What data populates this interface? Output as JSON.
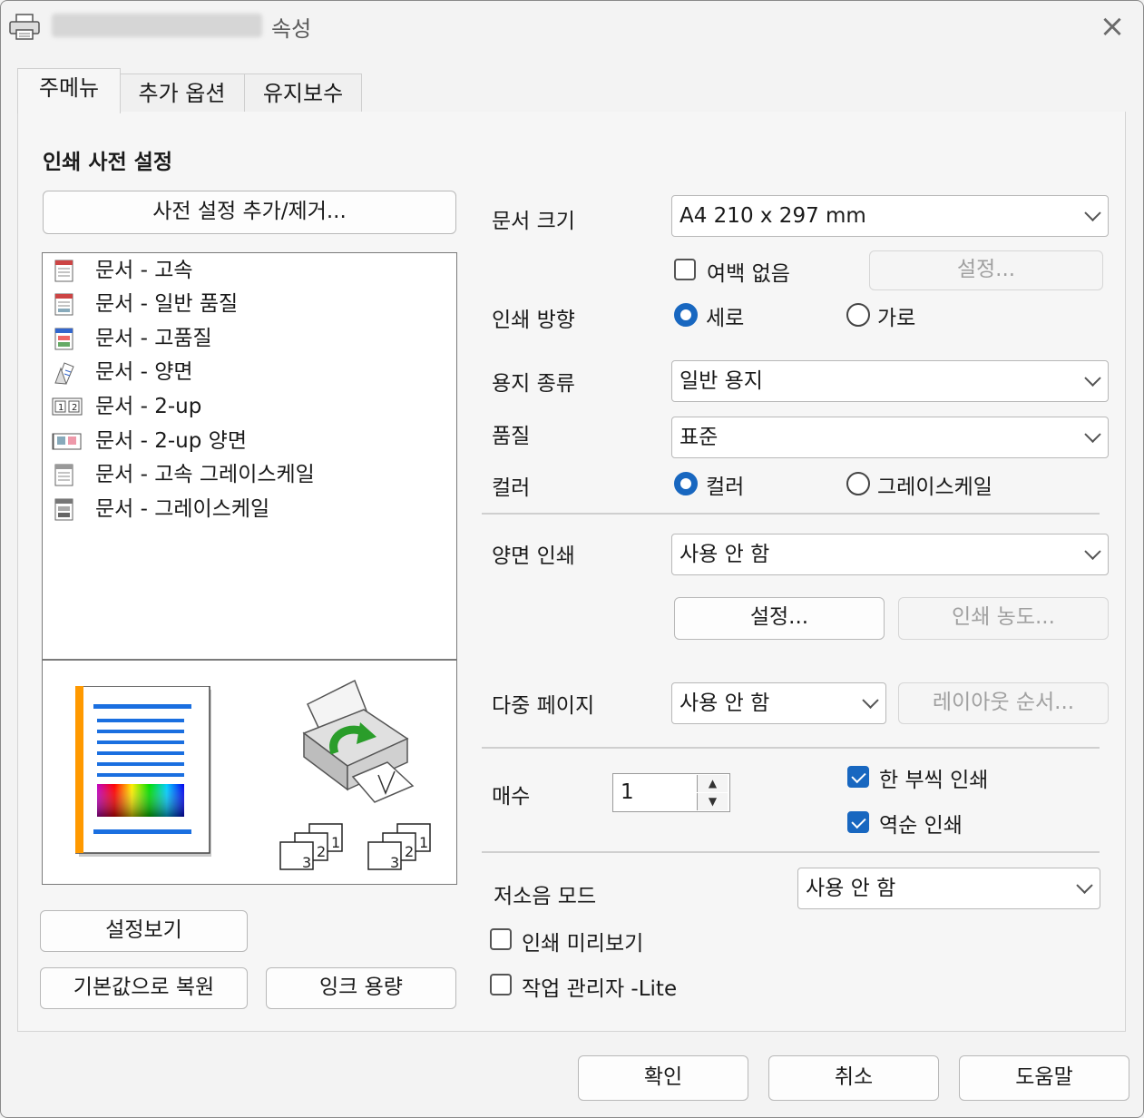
{
  "window": {
    "title": "속성",
    "close_label": "×"
  },
  "tabs": [
    {
      "label": "주메뉴",
      "active": true
    },
    {
      "label": "추가 옵션",
      "active": false
    },
    {
      "label": "유지보수",
      "active": false
    }
  ],
  "presets": {
    "heading": "인쇄 사전 설정",
    "add_remove_button": "사전 설정 추가/제거...",
    "items": [
      {
        "label": "문서 - 고속",
        "icon": "document-fast-icon"
      },
      {
        "label": "문서 - 일반 품질",
        "icon": "document-normal-icon"
      },
      {
        "label": "문서 - 고품질",
        "icon": "document-high-quality-icon"
      },
      {
        "label": "문서 - 양면",
        "icon": "document-duplex-icon"
      },
      {
        "label": "문서 - 2-up",
        "icon": "document-2up-icon"
      },
      {
        "label": "문서 - 2-up 양면",
        "icon": "document-2up-duplex-icon"
      },
      {
        "label": "문서 - 고속 그레이스케일",
        "icon": "document-fast-grayscale-icon"
      },
      {
        "label": "문서 - 그레이스케일",
        "icon": "document-grayscale-icon"
      }
    ]
  },
  "preview": {
    "collate_pages_a": [
      "1",
      "2",
      "3"
    ],
    "collate_pages_b": [
      "1",
      "2",
      "3"
    ],
    "colors": {
      "page_edge": "#ff9900",
      "lines": "#1a6fe0"
    }
  },
  "left_buttons": {
    "show_settings": "설정보기",
    "restore_defaults": "기본값으로 복원",
    "ink_levels": "잉크 용량"
  },
  "form": {
    "paper_size": {
      "label": "문서 크기",
      "value": "A4 210 x 297 mm"
    },
    "borderless": {
      "label": "여백 없음",
      "checked": false,
      "settings_button": "설정..."
    },
    "orientation": {
      "label": "인쇄 방향",
      "options": [
        "세로",
        "가로"
      ],
      "selected": "세로"
    },
    "paper_type": {
      "label": "용지 종류",
      "value": "일반 용지"
    },
    "quality": {
      "label": "품질",
      "value": "표준"
    },
    "color": {
      "label": "컬러",
      "options": [
        "컬러",
        "그레이스케일"
      ],
      "selected": "컬러"
    },
    "duplex": {
      "label": "양면 인쇄",
      "value": "사용 안 함",
      "settings_button": "설정...",
      "density_button": "인쇄 농도..."
    },
    "multi_page": {
      "label": "다중 페이지",
      "value": "사용 안 함",
      "layout_button": "레이아웃 순서..."
    },
    "copies": {
      "label": "매수",
      "value": "1"
    },
    "collate": {
      "label": "한 부씩 인쇄",
      "checked": true
    },
    "reverse": {
      "label": "역순 인쇄",
      "checked": true
    },
    "quiet_mode": {
      "label": "저소음 모드",
      "value": "사용 안 함"
    },
    "print_preview": {
      "label": "인쇄 미리보기",
      "checked": false
    },
    "job_monitor": {
      "label": "작업 관리자 -Lite",
      "checked": false
    }
  },
  "footer": {
    "ok": "확인",
    "cancel": "취소",
    "help": "도움말"
  },
  "accent_color": "#1867c0"
}
